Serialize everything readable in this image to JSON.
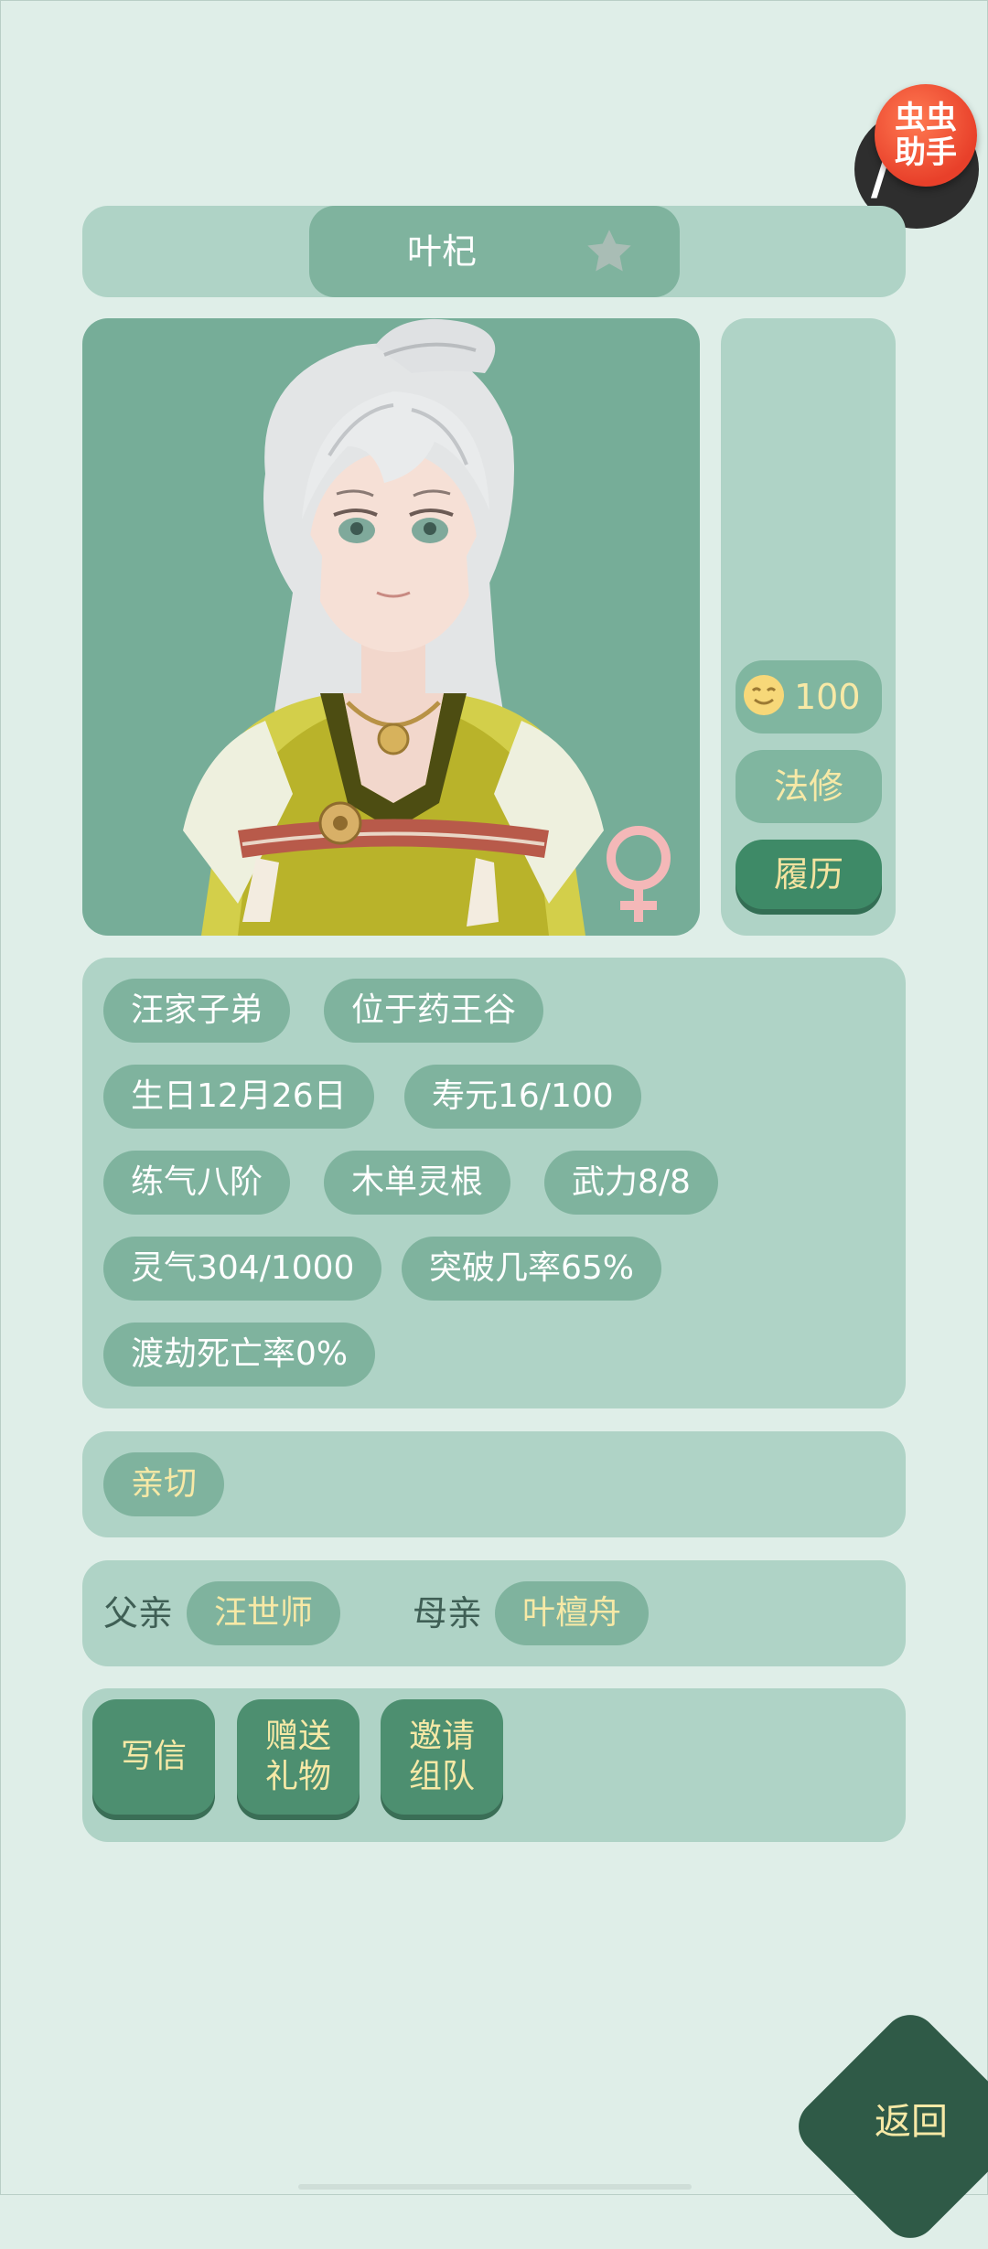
{
  "helper_badge": {
    "line1": "虫虫",
    "line2": "助手"
  },
  "character": {
    "name": "叶杞",
    "gender_symbol": "♀"
  },
  "side_panel": {
    "mood_value": "100",
    "school_label": "法修",
    "history_label": "履历"
  },
  "tags": [
    "汪家子弟",
    "位于药王谷",
    "生日12月26日",
    "寿元16/100",
    "练气八阶",
    "木单灵根",
    "武力8/8",
    "灵气304/1000",
    "突破几率65%",
    "渡劫死亡率0%"
  ],
  "traits": [
    "亲切"
  ],
  "family": {
    "father_label": "父亲",
    "father_name": "汪世师",
    "mother_label": "母亲",
    "mother_name": "叶檀舟"
  },
  "actions": {
    "write_letter": "写信",
    "gift_line1": "赠送",
    "gift_line2": "礼物",
    "invite_line1": "邀请",
    "invite_line2": "组队"
  },
  "back_label": "返回",
  "colors": {
    "background": "#dfeee8",
    "panel": "#afd3c6",
    "tag": "#7fb39e",
    "button_dark": "#4d8f70",
    "accent_text": "#f7e9a6",
    "back_button": "#2f5a47"
  }
}
